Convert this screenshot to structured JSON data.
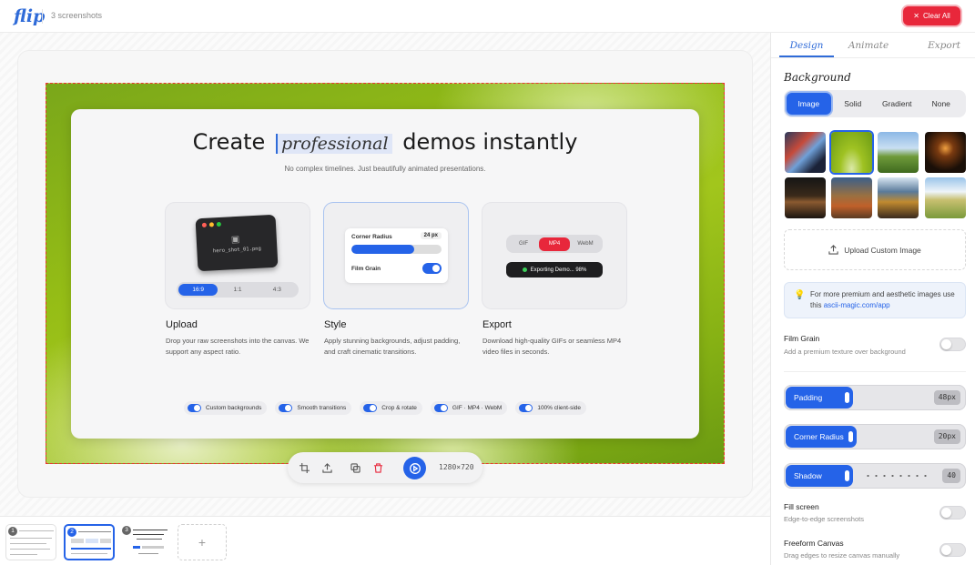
{
  "header": {
    "logo": "flip",
    "screenshot_count": "3 screenshots",
    "clear_all_label": "Clear All"
  },
  "hero": {
    "headline_pre": "Create",
    "headline_highlight": "professional",
    "headline_post": "demos instantly",
    "subtitle": "No complex timelines. Just beautifully animated presentations."
  },
  "features": [
    {
      "title": "Upload",
      "desc": "Drop your raw screenshots into the canvas. We support any aspect ratio.",
      "window_file": "hero_shot_01.png",
      "ratios": [
        "16:9",
        "1:1",
        "4:3"
      ],
      "active_ratio": "16:9"
    },
    {
      "title": "Style",
      "desc": "Apply stunning backgrounds, adjust padding, and craft cinematic transitions.",
      "corner_radius_label": "Corner Radius",
      "corner_radius_value": "24 px",
      "corner_radius_fraction": 0.7,
      "film_grain_label": "Film Grain"
    },
    {
      "title": "Export",
      "desc": "Download high-quality GIFs or seamless MP4 video files in seconds.",
      "formats": [
        "GIF",
        "MP4",
        "WebM"
      ],
      "active_format": "MP4",
      "progress_label": "Exporting Demo... 98%"
    }
  ],
  "chips": [
    "Custom backgrounds",
    "Smooth transitions",
    "Crop & rotate",
    "GIF · MP4 · WebM",
    "100% client-side"
  ],
  "toolbar": {
    "dimensions": "1280×720",
    "icons": [
      "crop-icon",
      "export-icon",
      "duplicate-icon",
      "trash-icon",
      "play-icon"
    ]
  },
  "filmstrip": {
    "numbers": [
      "1",
      "2",
      "3"
    ],
    "selected": "2",
    "add_label": "+"
  },
  "panel": {
    "tabs": [
      "Design",
      "Animate",
      "Export"
    ],
    "active_tab": "Design",
    "background_title": "Background",
    "bg_types": [
      "Image",
      "Solid",
      "Gradient",
      "None"
    ],
    "active_bg_type": "Image",
    "upload_label": "Upload Custom Image",
    "tip_text": "For more premium and aesthetic images use this",
    "tip_link": "ascii-magic.com/app",
    "film_grain": {
      "label": "Film Grain",
      "desc": "Add a premium texture over background"
    },
    "padding": {
      "label": "Padding",
      "value": "48px",
      "fraction": 0.38
    },
    "corner_radius": {
      "label": "Corner Radius",
      "value": "20px",
      "fraction": 0.4
    },
    "shadow": {
      "label": "Shadow",
      "value": "40",
      "fraction": 0.38
    },
    "fill_screen": {
      "label": "Fill screen",
      "desc": "Edge-to-edge screenshots"
    },
    "freeform": {
      "label": "Freeform Canvas",
      "desc": "Drag edges to resize canvas manually"
    }
  },
  "colors": {
    "accent": "#2563e8",
    "danger": "#e8273b"
  }
}
